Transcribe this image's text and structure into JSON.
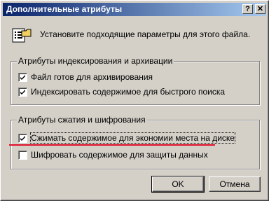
{
  "window": {
    "title": "Дополнительные атрибуты",
    "help_glyph": "?",
    "close_glyph": "✕"
  },
  "intro": {
    "icon": "file-properties-icon",
    "text": "Установите подходящие параметры для этого файла."
  },
  "indexing_group": {
    "title": "Атрибуты индексирования и архивации",
    "options": [
      {
        "label": "Файл готов для архивирования",
        "checked": true
      },
      {
        "label": "Индексировать содержимое для быстрого поиска",
        "checked": true
      }
    ]
  },
  "compression_group": {
    "title": "Атрибуты сжатия и шифрования",
    "options": [
      {
        "label": "Сжимать содержимое для экономии места на диске",
        "checked": true
      },
      {
        "label": "Шифровать содержимое для защиты данных",
        "checked": false
      }
    ]
  },
  "buttons": {
    "ok": "OK",
    "cancel": "Отмена"
  },
  "colors": {
    "title_start": "#0a246a",
    "title_end": "#a6caf0",
    "highlight_underline": "#e0102a",
    "face": "#d4d0c8"
  }
}
